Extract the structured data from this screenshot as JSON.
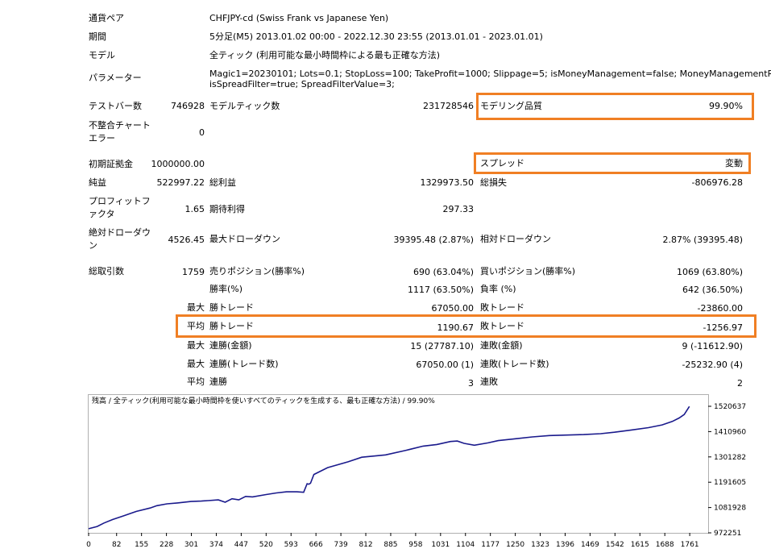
{
  "settings": {
    "pair_label": "通貨ペア",
    "pair_value": "CHFJPY-cd (Swiss Frank vs Japanese Yen)",
    "period_label": "期間",
    "period_value": "5分足(M5) 2013.01.02 00:00 - 2022.12.30 23:55 (2013.01.01 - 2023.01.01)",
    "model_label": "モデル",
    "model_value": "全ティック (利用可能な最小時間枠による最も正確な方法)",
    "params_label": "パラメーター",
    "params_line1": "Magic1=20230101; Lots=0.1; StopLoss=100; TakeProfit=1000; Slippage=5; isMoneyManagement=false; MoneyManagementRisk=3;",
    "params_line2": "isSpreadFilter=true; SpreadFilterValue=3;"
  },
  "stats": {
    "bars_label": "テストバー数",
    "bars_value": "746928",
    "ticks_label": "モデルティック数",
    "ticks_value": "231728546",
    "quality_label": "モデリング品質",
    "quality_value": "99.90%",
    "mismatch_label": "不整合チャート エラー",
    "mismatch_value": "0",
    "deposit_label": "初期証拠金",
    "deposit_value": "1000000.00",
    "spread_label": "スプレッド",
    "spread_value": "変動",
    "net_label": "純益",
    "net_value": "522997.22",
    "gross_profit_label": "総利益",
    "gross_profit_value": "1329973.50",
    "gross_loss_label": "総損失",
    "gross_loss_value": "-806976.28",
    "pf_label": "プロフィットファクタ",
    "pf_value": "1.65",
    "expected_label": "期待利得",
    "expected_value": "297.33",
    "abs_dd_label": "絶対ドローダウン",
    "abs_dd_value": "4526.45",
    "max_dd_label": "最大ドローダウン",
    "max_dd_value": "39395.48 (2.87%)",
    "rel_dd_label": "相対ドローダウン",
    "rel_dd_value": "2.87% (39395.48)",
    "total_trades_label": "総取引数",
    "total_trades_value": "1759",
    "short_label": "売りポジション(勝率%)",
    "short_value": "690 (63.04%)",
    "long_label": "買いポジション(勝率%)",
    "long_value": "1069 (63.80%)",
    "win_rate_label": "勝率(%)",
    "win_rate_value": "1117 (63.50%)",
    "loss_rate_label": "負率 (%)",
    "loss_rate_value": "642 (36.50%)",
    "max_word": "最大",
    "avg_word": "平均",
    "max_win_label": "勝トレード",
    "max_win_value": "67050.00",
    "max_loss_label": "敗トレード",
    "max_loss_value": "-23860.00",
    "avg_win_label": "勝トレード",
    "avg_win_value": "1190.67",
    "avg_loss_label": "敗トレード",
    "avg_loss_value": "-1256.97",
    "cons_wins_money_label": "連勝(金額)",
    "cons_wins_money_value": "15 (27787.10)",
    "cons_losses_money_label": "連敗(金額)",
    "cons_losses_money_value": "9 (-11612.90)",
    "cons_profit_label": "連勝(トレード数)",
    "cons_profit_value": "67050.00 (1)",
    "cons_loss_label": "連敗(トレード数)",
    "cons_loss_value": "-25232.90 (4)",
    "avg_cons_wins_label": "連勝",
    "avg_cons_wins_value": "3",
    "avg_cons_losses_label": "連敗",
    "avg_cons_losses_value": "2"
  },
  "colors": {
    "highlight": "#f07f24",
    "line": "#1a1a8c"
  },
  "chart_data": {
    "type": "line",
    "title": "残高 / 全ティック(利用可能な最小時間枠を使いすべてのティックを生成する、最も正確な方法) / 99.90%",
    "ylim": [
      972251,
      1520637
    ],
    "yticks": [
      972251,
      1081928,
      1191605,
      1301282,
      1410960,
      1520637
    ],
    "yticklabels": [
      "972251",
      "1081928",
      "1191605",
      "1301282",
      "1410960",
      "1520637"
    ],
    "xlim": [
      0,
      1815
    ],
    "xticks": [
      0,
      82,
      155,
      228,
      301,
      374,
      447,
      520,
      593,
      666,
      739,
      812,
      885,
      958,
      1031,
      1104,
      1177,
      1250,
      1323,
      1396,
      1469,
      1542,
      1615,
      1688,
      1761
    ],
    "xticklabels": [
      "0",
      "82",
      "155",
      "228",
      "301",
      "374",
      "447",
      "520",
      "593",
      "666",
      "739",
      "812",
      "885",
      "958",
      "1031",
      "1104",
      "1177",
      "1250",
      "1323",
      "1396",
      "1469",
      "1542",
      "1615",
      "1688",
      "1761"
    ],
    "series": [
      {
        "x": [
          0,
          25,
          45,
          70,
          100,
          140,
          180,
          200,
          230,
          260,
          300,
          330,
          350,
          380,
          400,
          420,
          440,
          460,
          480,
          520,
          550,
          580,
          610,
          630,
          640,
          645,
          650,
          660,
          700,
          760,
          800,
          870,
          930,
          980,
          1020,
          1060,
          1080,
          1100,
          1130,
          1170,
          1200,
          1250,
          1300,
          1350,
          1400,
          1450,
          1500,
          1540,
          1590,
          1640,
          1680,
          1710,
          1730,
          1745,
          1760
        ],
        "y": [
          990000,
          1000000,
          1015000,
          1030000,
          1045000,
          1065000,
          1080000,
          1090000,
          1098000,
          1102000,
          1108000,
          1110000,
          1112000,
          1115000,
          1105000,
          1120000,
          1115000,
          1130000,
          1128000,
          1138000,
          1145000,
          1150000,
          1150000,
          1148000,
          1185000,
          1183000,
          1187000,
          1225000,
          1255000,
          1280000,
          1300000,
          1310000,
          1330000,
          1348000,
          1355000,
          1368000,
          1370000,
          1360000,
          1352000,
          1362000,
          1372000,
          1380000,
          1388000,
          1394000,
          1396000,
          1398000,
          1402000,
          1408000,
          1418000,
          1428000,
          1440000,
          1455000,
          1470000,
          1485000,
          1520000
        ]
      }
    ]
  }
}
